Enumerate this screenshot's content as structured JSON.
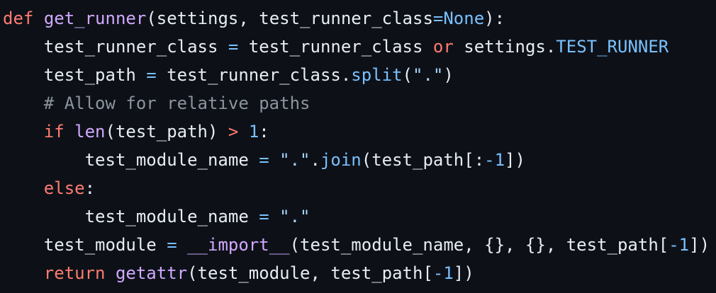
{
  "lines": [
    {
      "indent": "",
      "tokens": [
        {
          "t": "def",
          "c": "kw"
        },
        {
          "t": " ",
          "c": "txt"
        },
        {
          "t": "get_runner",
          "c": "fn"
        },
        {
          "t": "(settings, test_runner_class",
          "c": "txt"
        },
        {
          "t": "=",
          "c": "con"
        },
        {
          "t": "None",
          "c": "con"
        },
        {
          "t": "):",
          "c": "txt"
        }
      ]
    },
    {
      "indent": "    ",
      "tokens": [
        {
          "t": "test_runner_class ",
          "c": "txt"
        },
        {
          "t": "=",
          "c": "con"
        },
        {
          "t": " test_runner_class ",
          "c": "txt"
        },
        {
          "t": "or",
          "c": "kw"
        },
        {
          "t": " settings.",
          "c": "txt"
        },
        {
          "t": "TEST_RUNNER",
          "c": "con"
        }
      ]
    },
    {
      "indent": "    ",
      "tokens": [
        {
          "t": "test_path ",
          "c": "txt"
        },
        {
          "t": "=",
          "c": "con"
        },
        {
          "t": " test_runner_class.",
          "c": "txt"
        },
        {
          "t": "split",
          "c": "con"
        },
        {
          "t": "(",
          "c": "txt"
        },
        {
          "t": "\".\"",
          "c": "str"
        },
        {
          "t": ")",
          "c": "txt"
        }
      ]
    },
    {
      "indent": "    ",
      "tokens": [
        {
          "t": "# Allow for relative paths",
          "c": "com"
        }
      ]
    },
    {
      "indent": "    ",
      "tokens": [
        {
          "t": "if",
          "c": "kw"
        },
        {
          "t": " ",
          "c": "txt"
        },
        {
          "t": "len",
          "c": "fn"
        },
        {
          "t": "(test_path) ",
          "c": "txt"
        },
        {
          "t": ">",
          "c": "kw"
        },
        {
          "t": " ",
          "c": "txt"
        },
        {
          "t": "1",
          "c": "con"
        },
        {
          "t": ":",
          "c": "txt"
        }
      ]
    },
    {
      "indent": "        ",
      "tokens": [
        {
          "t": "test_module_name ",
          "c": "txt"
        },
        {
          "t": "=",
          "c": "con"
        },
        {
          "t": " ",
          "c": "txt"
        },
        {
          "t": "\".\"",
          "c": "str"
        },
        {
          "t": ".",
          "c": "txt"
        },
        {
          "t": "join",
          "c": "con"
        },
        {
          "t": "(test_path[:",
          "c": "txt"
        },
        {
          "t": "-1",
          "c": "con"
        },
        {
          "t": "])",
          "c": "txt"
        }
      ]
    },
    {
      "indent": "    ",
      "tokens": [
        {
          "t": "else",
          "c": "kw"
        },
        {
          "t": ":",
          "c": "txt"
        }
      ]
    },
    {
      "indent": "        ",
      "tokens": [
        {
          "t": "test_module_name ",
          "c": "txt"
        },
        {
          "t": "=",
          "c": "con"
        },
        {
          "t": " ",
          "c": "txt"
        },
        {
          "t": "\".\"",
          "c": "str"
        }
      ]
    },
    {
      "indent": "    ",
      "tokens": [
        {
          "t": "test_module ",
          "c": "txt"
        },
        {
          "t": "=",
          "c": "con"
        },
        {
          "t": " ",
          "c": "txt"
        },
        {
          "t": "__import__",
          "c": "fn"
        },
        {
          "t": "(test_module_name, {}, {}, test_path[",
          "c": "txt"
        },
        {
          "t": "-1",
          "c": "con"
        },
        {
          "t": "])",
          "c": "txt"
        }
      ]
    },
    {
      "indent": "    ",
      "tokens": [
        {
          "t": "return",
          "c": "kw"
        },
        {
          "t": " ",
          "c": "txt"
        },
        {
          "t": "getattr",
          "c": "fn"
        },
        {
          "t": "(test_module, test_path[",
          "c": "txt"
        },
        {
          "t": "-1",
          "c": "con"
        },
        {
          "t": "])",
          "c": "txt"
        }
      ]
    }
  ]
}
